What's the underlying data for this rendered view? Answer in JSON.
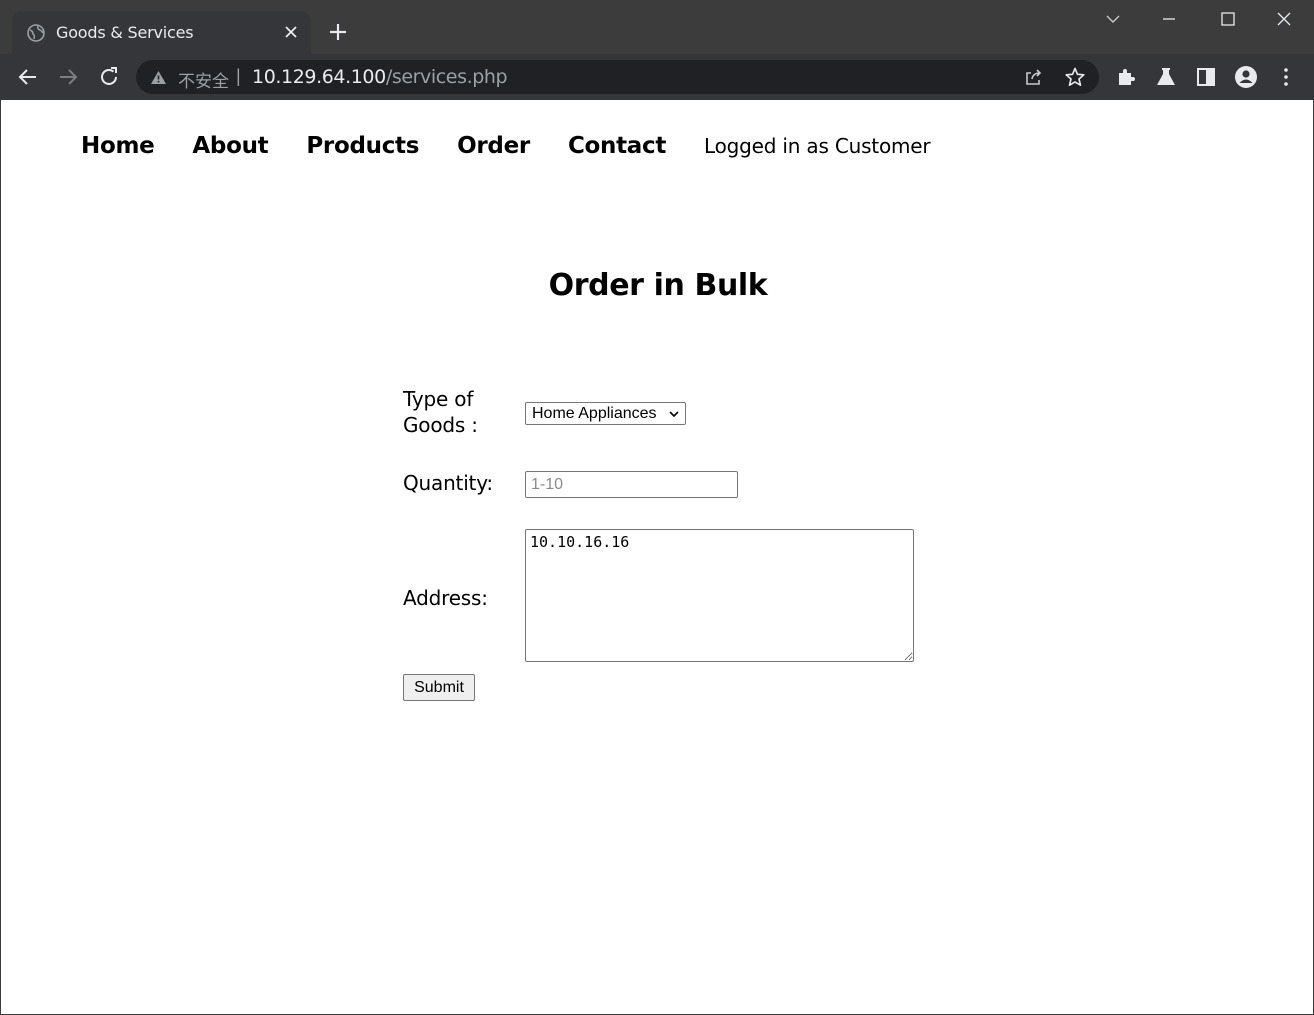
{
  "browser": {
    "tab_title": "Goods & Services",
    "security_text": "不安全",
    "separator": "|",
    "url_host": "10.129.64.100",
    "url_path": "/services.php"
  },
  "nav": {
    "items": [
      "Home",
      "About",
      "Products",
      "Order",
      "Contact"
    ],
    "status": "Logged in as Customer"
  },
  "page": {
    "heading": "Order in Bulk"
  },
  "form": {
    "goods_label_line1": "Type of",
    "goods_label_line2": "Goods :",
    "goods_selected": "Home Appliances",
    "quantity_label": "Quantity:",
    "quantity_placeholder": "1-10",
    "address_label": "Address:",
    "address_value": "10.10.16.16",
    "submit_label": "Submit"
  },
  "icons": {
    "tab_favicon": "globe-icon",
    "tab_close": "close-icon",
    "new_tab": "plus-icon",
    "back": "arrow-left-icon",
    "forward": "arrow-right-icon",
    "reload": "reload-icon",
    "warning": "warning-icon",
    "share": "share-icon",
    "bookmark": "star-icon",
    "extensions": "puzzle-icon",
    "labs": "flask-icon",
    "side_panel": "side-panel-icon",
    "profile": "profile-icon",
    "menu": "kebab-menu-icon"
  },
  "colors": {
    "chrome_dark": "#35363a",
    "titlebar": "#3c3c3c",
    "omnibox": "#202124"
  }
}
